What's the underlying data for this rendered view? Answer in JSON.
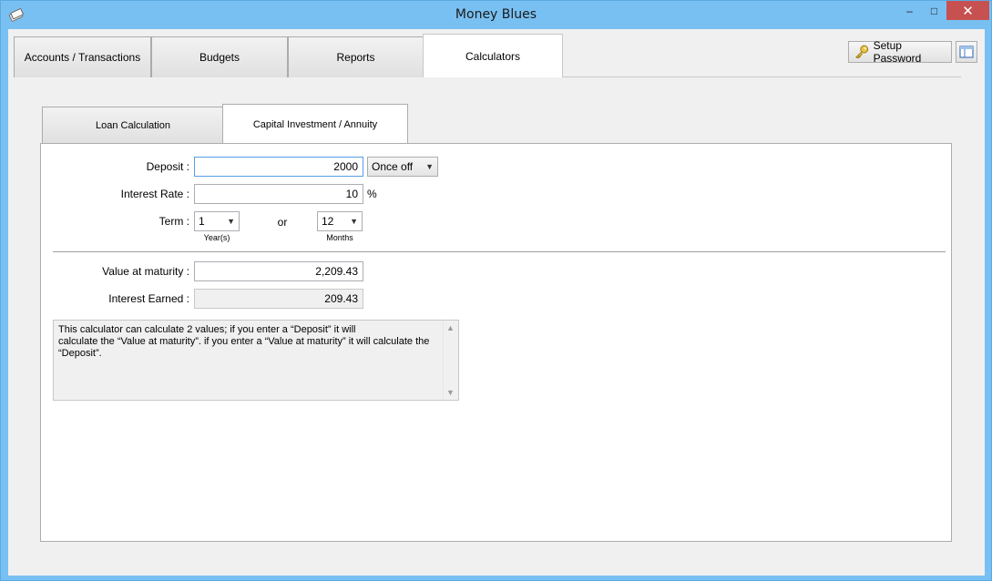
{
  "window": {
    "title": "Money Blues",
    "controls": {
      "minimize": "‒",
      "maximize": "□",
      "close": "✕"
    }
  },
  "main_tabs": [
    {
      "label": "Accounts / Transactions"
    },
    {
      "label": "Budgets"
    },
    {
      "label": "Reports"
    },
    {
      "label": "Calculators"
    }
  ],
  "toolbar": {
    "setup_password_label": "Setup Password",
    "setup_password_icon": "key-icon",
    "layout_icon": "panel-layout-icon"
  },
  "sub_tabs": [
    {
      "label": "Loan Calculation"
    },
    {
      "label": "Capital Investment / Annuity"
    }
  ],
  "form": {
    "deposit_label": "Deposit :",
    "deposit_value": "2000",
    "frequency_value": "Once off",
    "interest_rate_label": "Interest Rate :",
    "interest_rate_value": "10",
    "percent_sign": "%",
    "term_label": "Term :",
    "term_years_value": "1",
    "term_years_caption": "Year(s)",
    "or_label": "or",
    "term_months_value": "12",
    "term_months_caption": "Months",
    "maturity_label": "Value at maturity :",
    "maturity_value": "2,209.43",
    "interest_earned_label": "Interest Earned :",
    "interest_earned_value": "209.43"
  },
  "info": {
    "text": "This calculator can calculate 2 values; if you enter a “Deposit” it will\ncalculate the “Value at maturity”. if you enter a “Value at maturity” it will calculate the\n“Deposit”."
  },
  "colors": {
    "titlebar": "#79c0f2",
    "close_button": "#c75050",
    "focus_border": "#569de5"
  }
}
